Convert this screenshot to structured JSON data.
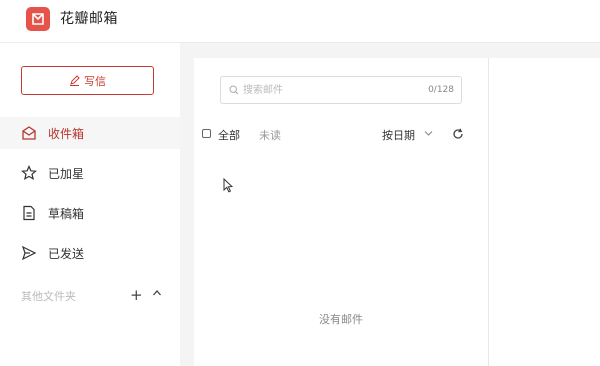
{
  "app": {
    "title": "花瓣邮箱",
    "logo_icon": "mail-logo-icon",
    "accent": "#c73a32"
  },
  "sidebar": {
    "compose_label": "写信",
    "items": [
      {
        "label": "收件箱",
        "icon": "inbox-icon",
        "active": true
      },
      {
        "label": "已加星",
        "icon": "star-icon",
        "active": false
      },
      {
        "label": "草稿箱",
        "icon": "draft-icon",
        "active": false
      },
      {
        "label": "已发送",
        "icon": "send-icon",
        "active": false
      }
    ],
    "folders_label": "其他文件夹",
    "add_label": "+"
  },
  "list": {
    "search_placeholder": "搜索邮件",
    "search_value": "",
    "count": "0/128",
    "select_all_label": "全部",
    "unread_label": "未读",
    "sort_label": "按日期",
    "empty_text": "没有邮件"
  }
}
